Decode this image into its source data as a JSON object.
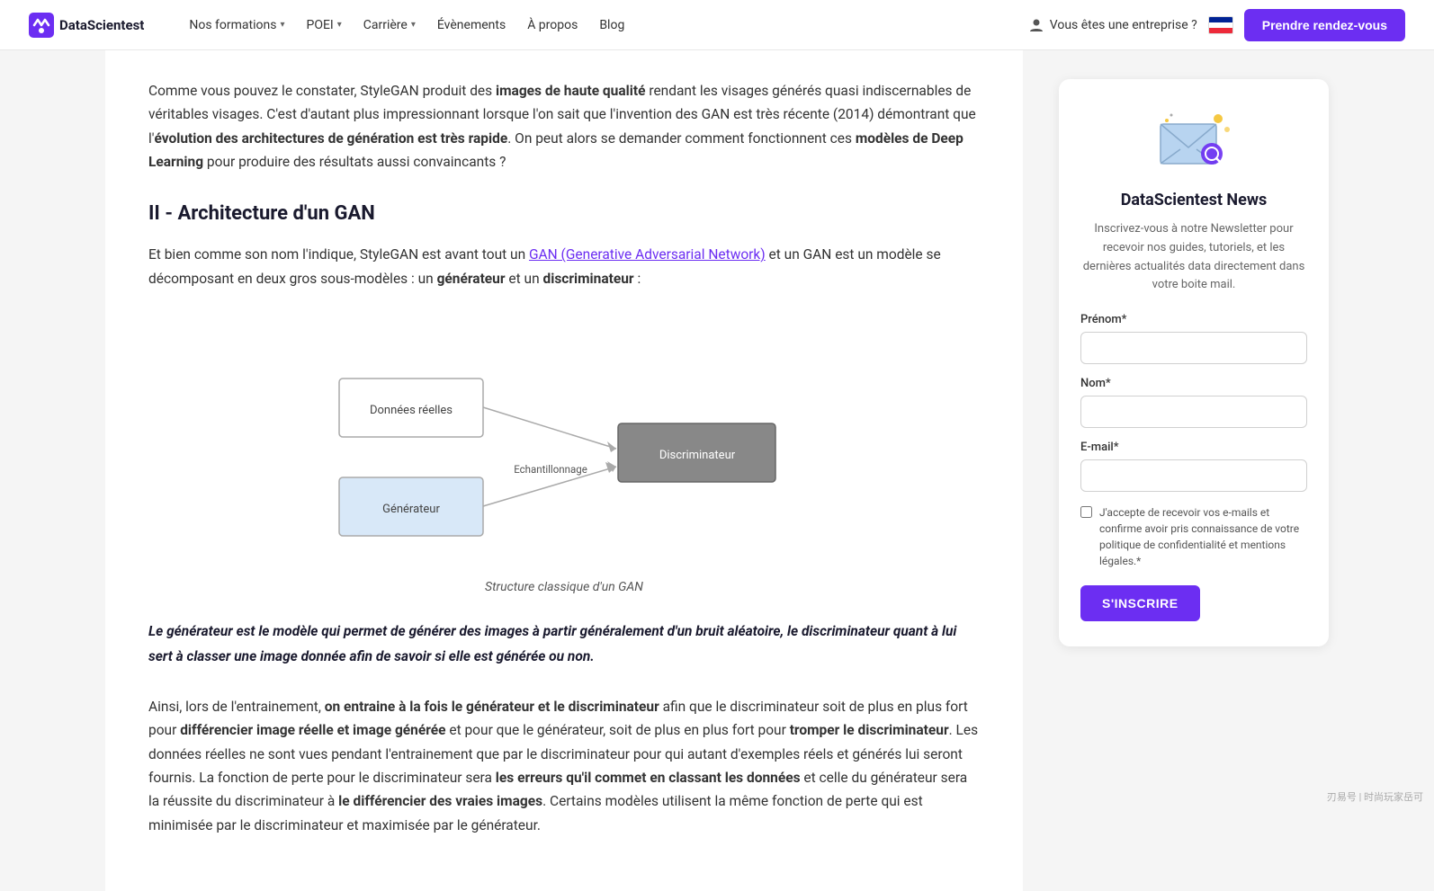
{
  "nav": {
    "logo_text": "DataScientest",
    "links": [
      {
        "label": "Nos formations",
        "has_dropdown": true
      },
      {
        "label": "POEI",
        "has_dropdown": true
      },
      {
        "label": "Carrière",
        "has_dropdown": true
      },
      {
        "label": "Évènements",
        "has_dropdown": false
      },
      {
        "label": "À propos",
        "has_dropdown": false
      },
      {
        "label": "Blog",
        "has_dropdown": false
      }
    ],
    "enterprise_label": "Vous êtes une entreprise ?",
    "cta_label": "Prendre rendez-vous"
  },
  "main": {
    "intro_p1_before": "Comme vous pouvez le constater, StyleGAN produit des ",
    "intro_bold1": "images de haute qualité",
    "intro_p1_after": " rendant les visages générés quasi indiscernables de véritables visages. C'est d'autant plus impressionnant lorsque l'on sait que l'invention des GAN est très récente (2014) démontrant que l'",
    "intro_bold2": "évolution des architectures de génération est très rapide",
    "intro_p1_end": ". On peut alors se demander comment fonctionnent ces ",
    "intro_bold3": "modèles de Deep Learning",
    "intro_p1_final": " pour produire des résultats aussi convaincants ?",
    "section_title": "II - Architecture d'un GAN",
    "body_before_link": "Et bien comme son nom l'indique, StyleGAN est avant tout un ",
    "link_text": "GAN (Generative Adversarial Network)",
    "body_after_link": " et un GAN est un modèle se décomposant en deux gros sous-modèles : un ",
    "body_bold1": "générateur",
    "body_mid": " et un ",
    "body_bold2": "discriminateur",
    "body_end": " :",
    "diagram_caption": "Structure classique d'un GAN",
    "diagram": {
      "box_donnees": "Données réelles",
      "box_generateur": "Générateur",
      "box_discriminateur": "Discriminateur",
      "arrow_label": "Echantillonnage"
    },
    "blockquote": "Le générateur est le modèle qui permet de générer des images à partir généralement d'un bruit aléatoire, le discriminateur quant à lui sert à classer une image donnée afin de savoir si elle est générée ou non.",
    "body2_before": "Ainsi, lors de l'entrainement, ",
    "body2_bold1": "on entraine à la fois le générateur et le discriminateur",
    "body2_mid1": " afin que le discriminateur soit de plus en plus fort pour ",
    "body2_bold2": "différencier image réelle et image générée",
    "body2_mid2": " et pour que le générateur, soit de plus en plus fort pour ",
    "body2_bold3": "tromper le discriminateur",
    "body2_mid3": ". Les données réelles ne sont vues pendant l'entrainement que par le discriminateur pour qui autant d'exemples réels et générés lui seront fournis. La fonction de perte pour le discriminateur sera ",
    "body2_bold4": "les erreurs qu'il commet en classant les données",
    "body2_mid4": " et celle du générateur sera la réussite du discriminateur à ",
    "body2_bold5": "le différencier des vraies images",
    "body2_end": ". Certains modèles utilisent la même fonction de perte qui est minimisée par le discriminateur et maximisée par le générateur."
  },
  "sidebar": {
    "title": "DataScientest News",
    "description": "Inscrivez-vous à notre Newsletter pour recevoir nos guides, tutoriels, et les dernières actualités data directement dans votre boite mail.",
    "prenom_label": "Prénom*",
    "nom_label": "Nom*",
    "email_label": "E-mail*",
    "prenom_placeholder": "",
    "nom_placeholder": "",
    "email_placeholder": "",
    "checkbox_text": "J'accepte de recevoir vos e-mails et confirme avoir pris connaissance de votre politique de confidentialité et mentions légales.*",
    "submit_label": "S'INSCRIRE"
  },
  "watermark": "刃易号 | 时尚玩家岳可"
}
